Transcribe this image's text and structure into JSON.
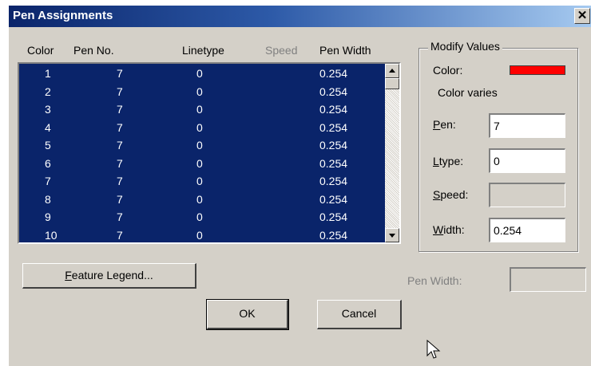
{
  "window": {
    "title": "Pen Assignments",
    "close_glyph": "✕"
  },
  "table": {
    "headers": {
      "color": "Color",
      "pen_no": "Pen No.",
      "linetype": "Linetype",
      "speed": "Speed",
      "pen_width": "Pen Width"
    },
    "rows": [
      {
        "color": "1",
        "pen": "7",
        "linetype": "0",
        "width": "0.254"
      },
      {
        "color": "2",
        "pen": "7",
        "linetype": "0",
        "width": "0.254"
      },
      {
        "color": "3",
        "pen": "7",
        "linetype": "0",
        "width": "0.254"
      },
      {
        "color": "4",
        "pen": "7",
        "linetype": "0",
        "width": "0.254"
      },
      {
        "color": "5",
        "pen": "7",
        "linetype": "0",
        "width": "0.254"
      },
      {
        "color": "6",
        "pen": "7",
        "linetype": "0",
        "width": "0.254"
      },
      {
        "color": "7",
        "pen": "7",
        "linetype": "0",
        "width": "0.254"
      },
      {
        "color": "8",
        "pen": "7",
        "linetype": "0",
        "width": "0.254"
      },
      {
        "color": "9",
        "pen": "7",
        "linetype": "0",
        "width": "0.254"
      },
      {
        "color": "10",
        "pen": "7",
        "linetype": "0",
        "width": "0.254"
      }
    ]
  },
  "modify": {
    "title": "Modify Values",
    "color_label": "Color:",
    "color_swatch": "#ff0000",
    "color_varies": "Color varies",
    "pen": {
      "mnemonic": "P",
      "rest": "en:",
      "value": "7"
    },
    "ltype": {
      "mnemonic": "L",
      "rest": "type:",
      "value": "0"
    },
    "speed": {
      "mnemonic": "S",
      "rest": "peed:",
      "value": ""
    },
    "width": {
      "mnemonic": "W",
      "rest": "idth:",
      "value": "0.254"
    }
  },
  "bottom": {
    "feature_legend": {
      "mnemonic": "F",
      "rest": "eature Legend..."
    },
    "pen_width_label": "Pen Width:",
    "pen_width_value": "",
    "ok": "OK",
    "cancel": "Cancel"
  },
  "colors": {
    "titlebar": "#0a246a",
    "list_bg": "#0a246a",
    "dialog_bg": "#d4d0c8"
  }
}
